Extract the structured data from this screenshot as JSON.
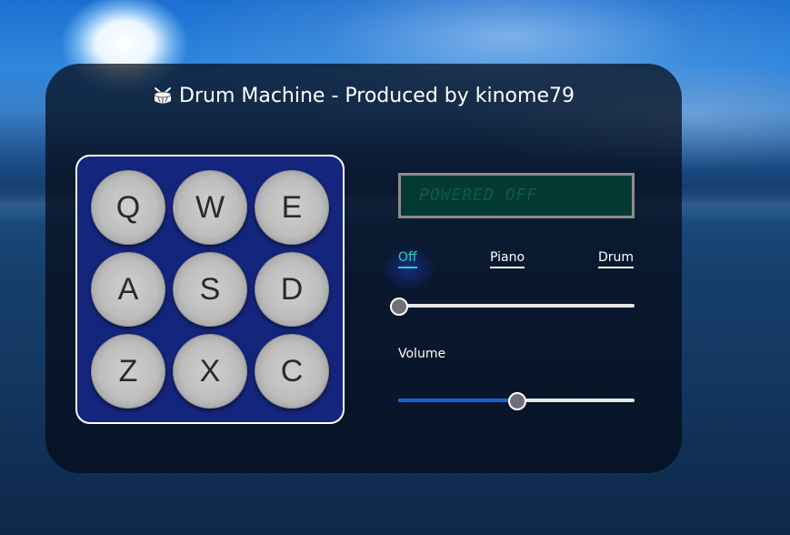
{
  "app": {
    "title": "Drum Machine - Produced by kinome79",
    "title_icon": "drum-icon"
  },
  "pads": [
    {
      "key": "Q"
    },
    {
      "key": "W"
    },
    {
      "key": "E"
    },
    {
      "key": "A"
    },
    {
      "key": "S"
    },
    {
      "key": "D"
    },
    {
      "key": "Z"
    },
    {
      "key": "X"
    },
    {
      "key": "C"
    }
  ],
  "display": {
    "text": "POWERED OFF"
  },
  "modes": {
    "options": [
      "Off",
      "Piano",
      "Drum"
    ],
    "selected": "Off",
    "selected_index": 0
  },
  "volume": {
    "label": "Volume",
    "value_fraction": 0.5
  },
  "colors": {
    "panel_background": "#040a16",
    "pad_area": "#16288c",
    "active_mode": "#2fd0c4",
    "slider_fill": "#1a5fd6",
    "display_background": "#053a33",
    "display_text": "#0c5b50"
  }
}
